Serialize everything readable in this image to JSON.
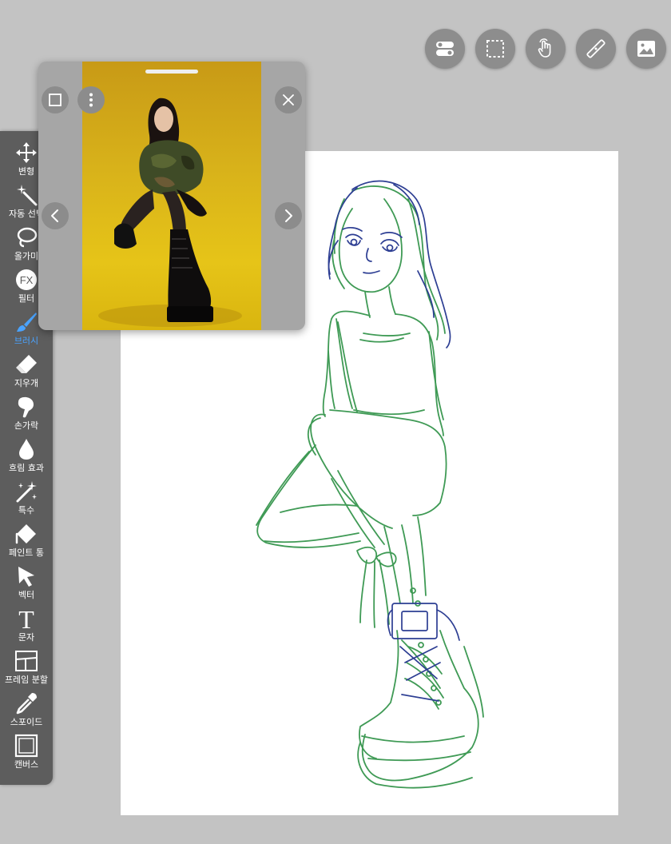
{
  "top_toolbar": {
    "icons": [
      "toggle-layers-icon",
      "selection-rect-icon",
      "hand-touch-icon",
      "ruler-icon",
      "image-reference-icon"
    ]
  },
  "tools": [
    {
      "label": "변형",
      "icon": "move-icon"
    },
    {
      "label": "자동 선택",
      "icon": "magic-wand-icon"
    },
    {
      "label": "올가미",
      "icon": "lasso-icon"
    },
    {
      "label": "필터",
      "icon": "fx-icon"
    },
    {
      "label": "브러시",
      "icon": "brush-icon"
    },
    {
      "label": "지우개",
      "icon": "eraser-icon"
    },
    {
      "label": "손가락",
      "icon": "smudge-finger-icon"
    },
    {
      "label": "흐림 효과",
      "icon": "blur-drop-icon"
    },
    {
      "label": "특수",
      "icon": "sparkle-icon"
    },
    {
      "label": "페인트 통",
      "icon": "paint-bucket-icon"
    },
    {
      "label": "벡터",
      "icon": "vector-arrow-icon"
    },
    {
      "label": "문자",
      "icon": "text-icon"
    },
    {
      "label": "프레임 분할",
      "icon": "frame-divider-icon"
    },
    {
      "label": "스포이드",
      "icon": "eyedropper-icon"
    },
    {
      "label": "캔버스",
      "icon": "canvas-icon"
    }
  ],
  "active_tool": "브러시",
  "reference_window": {
    "buttons": [
      "fit-frame-icon",
      "more-options-icon",
      "close-icon",
      "previous-icon",
      "next-icon"
    ]
  },
  "colors": {
    "toolbar_bg": "#5d5d5d",
    "active_tool": "#4aa3ff",
    "sketch_green": "#3f9a55",
    "sketch_blue": "#2d3e93"
  },
  "text_glyphs": {
    "fx": "FX",
    "text_tool": "T"
  }
}
